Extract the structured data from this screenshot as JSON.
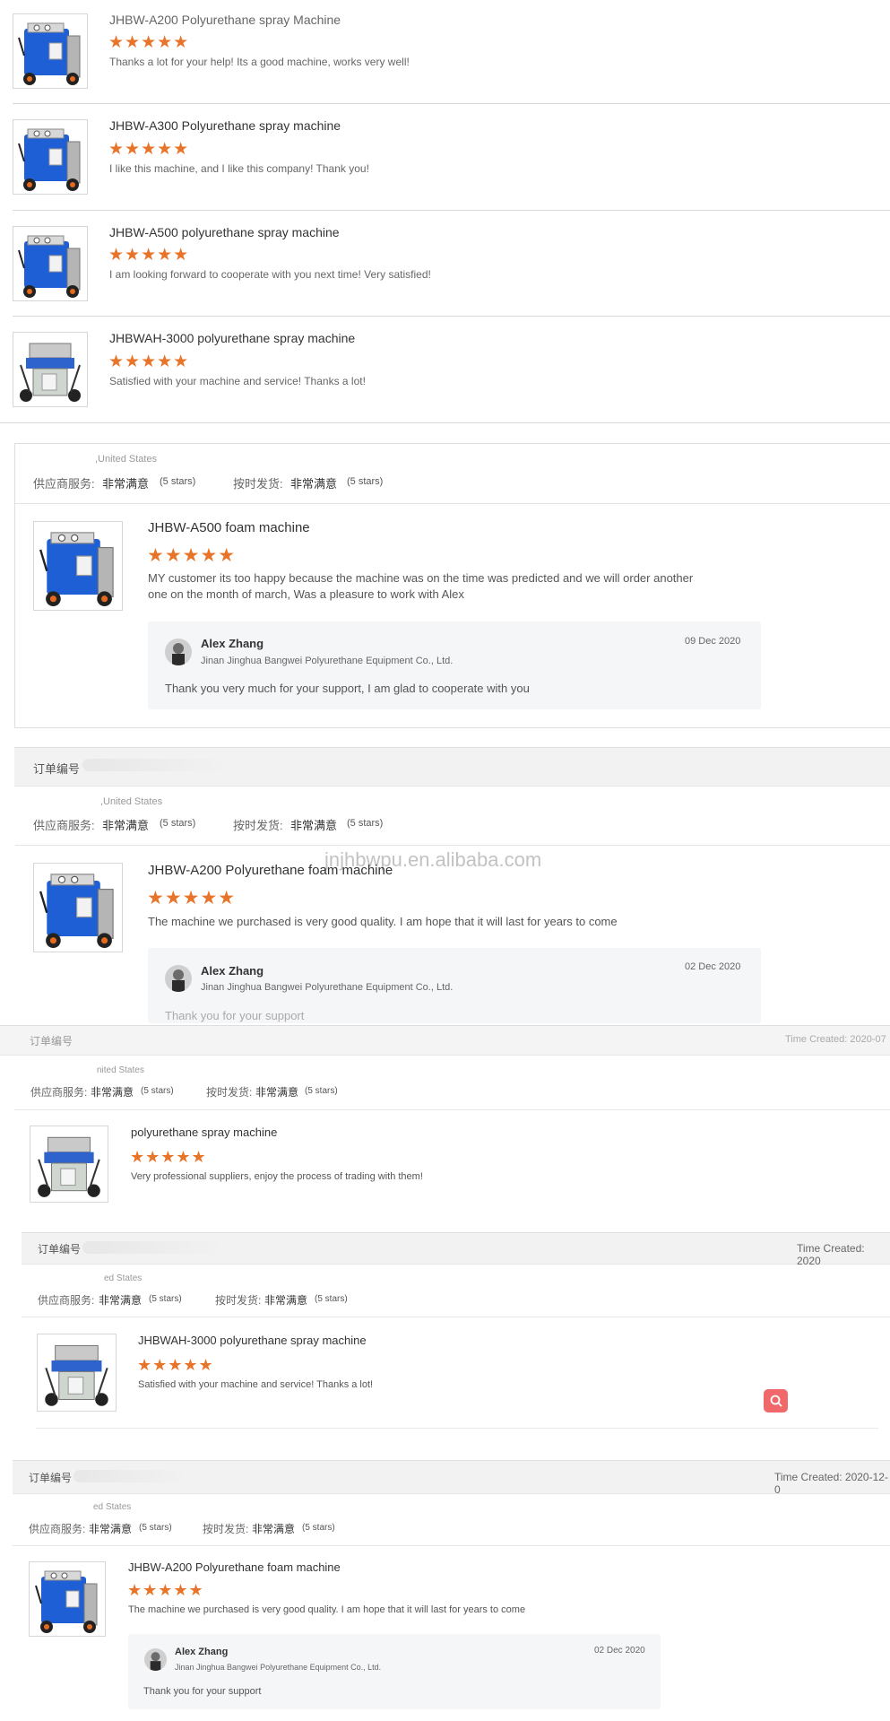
{
  "top_reviews": [
    {
      "product": "JHBW-A200 Polyurethane spray Machine",
      "stars": "★★★★★",
      "comment": "Thanks a lot for your help! Its a good machine, works very well!"
    },
    {
      "product": "JHBW-A300 Polyurethane spray machine",
      "stars": "★★★★★",
      "comment": "I like this machine, and I like this company! Thank you!"
    },
    {
      "product": "JHBW-A500 polyurethane spray machine",
      "stars": "★★★★★",
      "comment": "I am looking forward to cooperate with you next time! Very satisfied!"
    },
    {
      "product": "JHBWAH-3000 polyurethane spray machine",
      "stars": "★★★★★",
      "comment": "Satisfied with  your machine and service! Thanks a lot!"
    }
  ],
  "labels": {
    "order_no": "订单编号",
    "supplier_service": "供应商服务:",
    "on_time_shipping": "按时发货:",
    "very_satisfied": "非常满意",
    "five_stars": "(5 stars)",
    "country": ",United States",
    "country_partial": "nited States",
    "country_partial2": "ed States"
  },
  "watermark": "jnjhbwpu.en.alibaba.com",
  "orders": [
    {
      "product": "JHBW-A500 foam machine",
      "stars": "★★★★★",
      "comment_line1": "MY customer its too happy because the machine was on the time was predicted and we will order another",
      "comment_line2": "one on the month of march, Was a pleasure to work with Alex",
      "reply": {
        "name": "Alex Zhang",
        "company": "Jinan Jinghua Bangwei Polyurethane Equipment Co., Ltd.",
        "date": "09 Dec 2020",
        "text": "Thank you very much for your support, I am glad to cooperate with you"
      }
    },
    {
      "product": "JHBW-A200 Polyurethane foam machine",
      "stars": "★★★★★",
      "comment": "The machine we purchased is very good quality.  I am hope that it will last for years to come",
      "reply": {
        "name": "Alex Zhang",
        "company": "Jinan Jinghua Bangwei Polyurethane Equipment Co., Ltd.",
        "date": "02 Dec 2020",
        "text": "Thank you for your support"
      }
    },
    {
      "time_created": "Time Created: 2020-07",
      "product": "polyurethane spray machine",
      "stars": "★★★★★",
      "comment": "Very professional suppliers, enjoy the process of trading with them!"
    },
    {
      "time_created": "Time Created: 2020",
      "product": "JHBWAH-3000 polyurethane spray machine",
      "stars": "★★★★★",
      "comment": "Satisfied with  your machine and service! Thanks a lot!"
    },
    {
      "time_created": "Time Created: 2020-12-0",
      "product": "JHBW-A200 Polyurethane foam machine",
      "stars": "★★★★★",
      "comment": "The machine we purchased is very good quality.  I am hope that it will last for years to come",
      "reply": {
        "name": "Alex Zhang",
        "company": "Jinan Jinghua Bangwei Polyurethane Equipment Co., Ltd.",
        "date": "02 Dec 2020",
        "text": "Thank you for your support"
      }
    }
  ],
  "colors": {
    "star": "#e8742a",
    "machine_blue": "#1f5fd6",
    "search_button": "#f0686a"
  },
  "icons": [
    "star-icon",
    "machine-thumbnail",
    "avatar",
    "search-icon"
  ]
}
